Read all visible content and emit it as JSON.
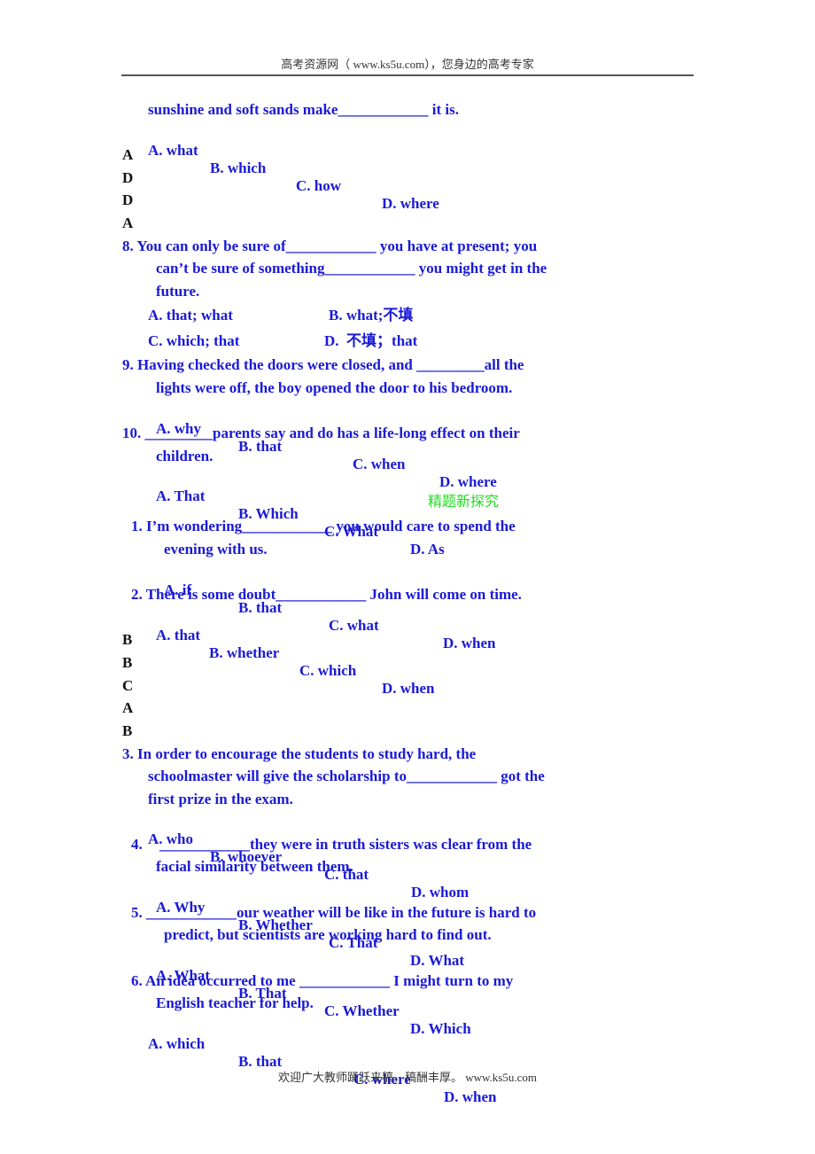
{
  "header": {
    "text": "高考资源网（  www.ks5u.com），您身边的高考专家"
  },
  "footer": {
    "text": "欢迎广大教师踊跃来稿，稿酬丰厚。  www.ks5u.com"
  },
  "colors": {
    "question_text": "#1a1ad6",
    "answer_text": "#111111",
    "section_title": "#22dd22",
    "header_rule": "#555555"
  },
  "section1": {
    "q7_tail": {
      "line": "sunshine and soft sands make____________ it is.",
      "options": [
        "A. what",
        "B. which",
        "C. how",
        "D. where"
      ]
    },
    "answers": [
      "A",
      "D",
      "D",
      "A"
    ],
    "q8": {
      "lines": [
        "8. You can only be sure of____________ you have at present; you",
        "can’t be sure of something____________ you might get in the",
        "future."
      ],
      "options": [
        "A. that; what",
        "B. what;不填",
        "C. which; that",
        "D.  不填；that"
      ]
    },
    "q9": {
      "lines": [
        "9. Having checked the doors were closed, and _________all the",
        "lights were off, the boy opened the door to his bedroom."
      ],
      "options": [
        "A. why",
        "B. that",
        "C. when",
        "D. where"
      ]
    },
    "q10": {
      "lines": [
        "10. _________parents say and do has a life-long effect on their",
        "children."
      ],
      "options": [
        "A. That",
        "B. Which",
        "C. What",
        "D. As"
      ]
    }
  },
  "section2": {
    "title": "精题新探究",
    "q1": {
      "lines": [
        "1. I’m wondering____________ you would care to spend the",
        "evening with us."
      ],
      "options": [
        "A. if",
        "B. that",
        "C. what",
        "D. when"
      ]
    },
    "q2": {
      "lines": [
        "2. There is some doubt____________ John will come on time."
      ],
      "options": [
        "A. that",
        "B. whether",
        "C. which",
        "D. when"
      ]
    },
    "answers": [
      "B",
      "B",
      "C",
      "A",
      "B"
    ],
    "q3": {
      "lines": [
        "3. In order to encourage the students to study hard, the",
        "schoolmaster will give the scholarship to____________ got the",
        "first prize in the exam."
      ],
      "options": [
        "A. who",
        "B. whoever",
        "C. that",
        "D. whom"
      ]
    },
    "q4": {
      "number": "4.",
      "lines": [
        "____________they were in truth sisters was clear from the",
        "facial similarity between them."
      ],
      "options": [
        "A. Why",
        "B. Whether",
        "C. That",
        "D. What"
      ]
    },
    "q5": {
      "lines": [
        "5. ____________our weather will be like in the future is hard to",
        "predict, but scientists are working hard to find out."
      ],
      "options": [
        "A. What",
        "B. That",
        "C. Whether",
        "D. Which"
      ]
    },
    "q6": {
      "lines": [
        "6. An idea occurred to me ____________ I might turn to my",
        "English teacher for help."
      ],
      "options": [
        "A. which",
        "B. that",
        "C. where",
        "D. when"
      ]
    }
  }
}
